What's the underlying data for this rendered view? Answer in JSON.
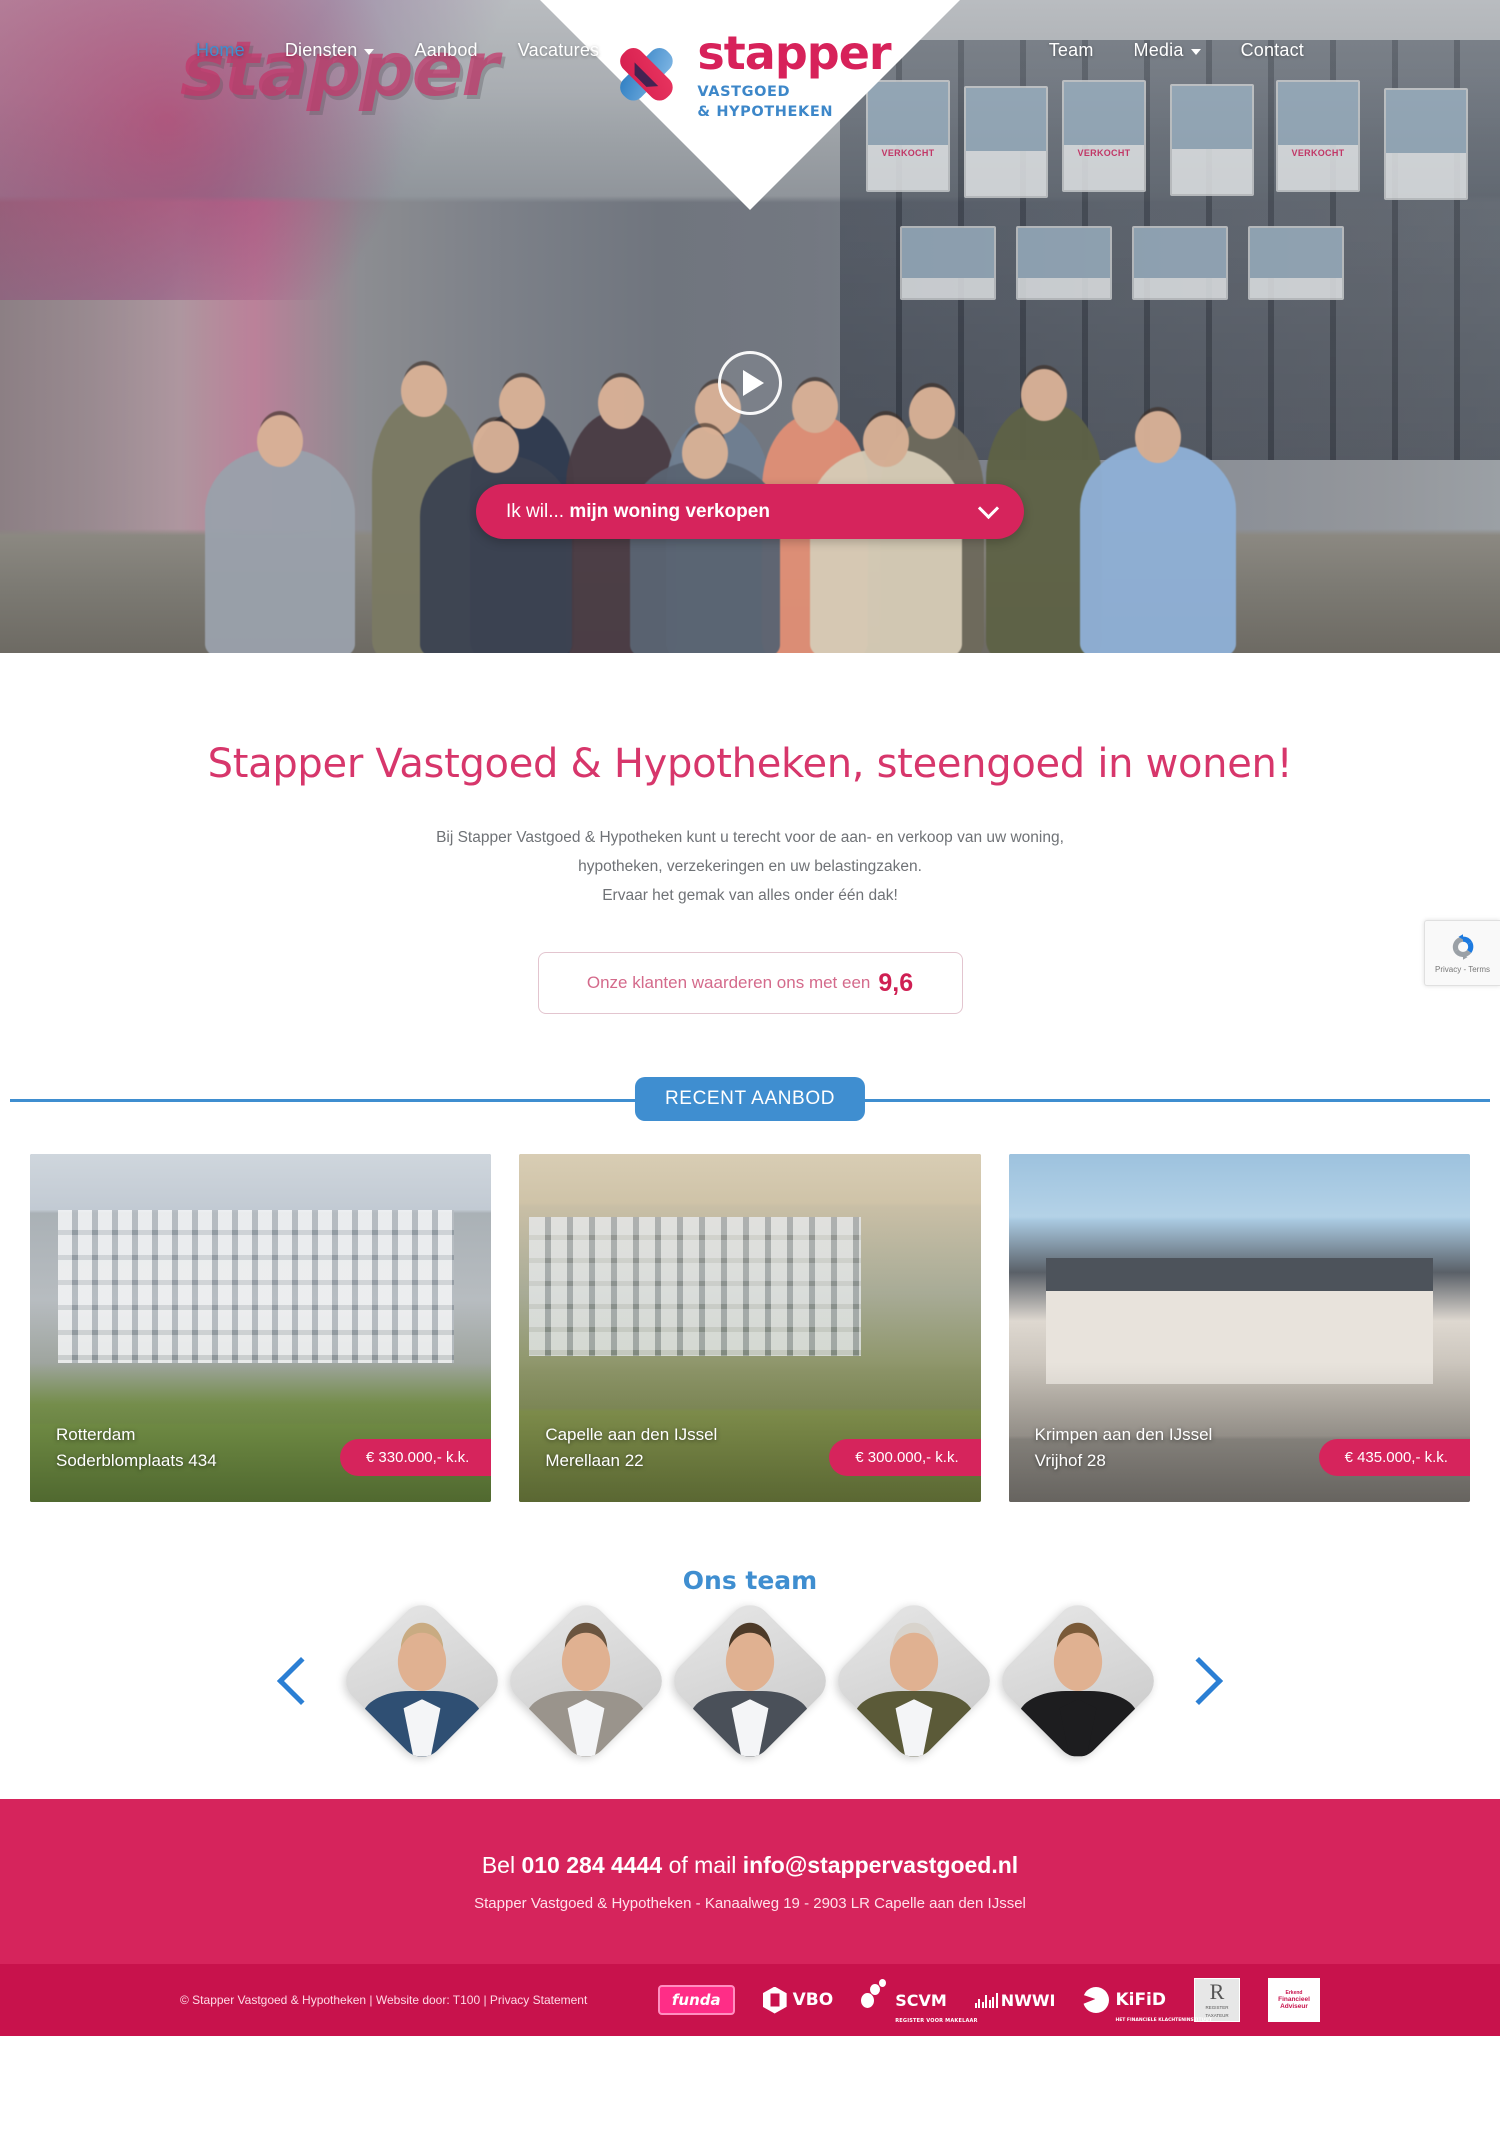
{
  "brand": {
    "word": "stapper",
    "sub1": "VASTGOED",
    "sub2": "& HYPOTHEKEN",
    "wall_sign": "stapper",
    "accent_pink": "#d6245c",
    "accent_blue": "#3f8ed0",
    "logo_blue": "#3d87c9",
    "logo_red": "#d7225a"
  },
  "nav": {
    "left": [
      {
        "label": "Home",
        "has_caret": false,
        "active": true
      },
      {
        "label": "Diensten",
        "has_caret": true,
        "active": false
      },
      {
        "label": "Aanbod",
        "has_caret": false,
        "active": false
      },
      {
        "label": "Vacatures",
        "has_caret": false,
        "active": false
      }
    ],
    "right": [
      {
        "label": "Team",
        "has_caret": false
      },
      {
        "label": "Media",
        "has_caret": true
      },
      {
        "label": "Contact",
        "has_caret": false
      }
    ]
  },
  "hero": {
    "play_icon": "play-icon",
    "cta_prefix": "Ik wil...",
    "cta_strong": "mijn woning verkopen",
    "cta_icon": "chevron-down-icon",
    "posters": [
      "VERKOCHT",
      "VERKOCHT",
      "VERKOCHT"
    ]
  },
  "intro": {
    "heading": "Stapper Vastgoed & Hypotheken, steengoed in wonen!",
    "paragraph_lines": [
      "Bij Stapper Vastgoed & Hypotheken kunt u terecht voor de aan- en verkoop van uw woning,",
      "hypotheken, verzekeringen en uw belastingzaken.",
      "Ervaar het gemak van alles onder één dak!"
    ],
    "line1": "Bij Stapper Vastgoed & Hypotheken kunt u terecht voor de aan- en verkoop van uw woning,",
    "line2": "hypotheken, verzekeringen en uw belastingzaken.",
    "line3": "Ervaar het gemak van alles onder één dak!",
    "rating_text": "Onze klanten waarderen ons met een",
    "rating_value": "9,6"
  },
  "recaptcha": {
    "label": "Privacy - Terms",
    "icon": "recaptcha-icon"
  },
  "listings": {
    "section_title": "RECENT AANBOD",
    "items": [
      {
        "city": "Rotterdam",
        "street": "Soderblomplaats 434",
        "price": "€ 330.000,- k.k."
      },
      {
        "city": "Capelle aan den IJssel",
        "street": "Merellaan 22",
        "price": "€ 300.000,- k.k."
      },
      {
        "city": "Krimpen aan den IJssel",
        "street": "Vrijhof 28",
        "price": "€ 435.000,- k.k."
      }
    ]
  },
  "team": {
    "title": "Ons team",
    "prev_icon": "chevron-left-icon",
    "next_icon": "chevron-right-icon",
    "members": [
      {
        "suit": "#2f4f73",
        "hair": "#c9ab82"
      },
      {
        "suit": "#9a948c",
        "hair": "#6b5540"
      },
      {
        "suit": "#4a5059",
        "hair": "#4d3a28"
      },
      {
        "suit": "#5b5a38",
        "hair": "#d8d3cc"
      },
      {
        "suit": "#1d1d1f",
        "hair": "#7a5a38"
      }
    ]
  },
  "footer": {
    "call_prefix": "Bel",
    "phone": "010 284 4444",
    "mail_mid": "of mail",
    "email": "info@stappervastgoed.nl",
    "address": "Stapper Vastgoed & Hypotheken - Kanaalweg 19 - 2903 LR Capelle aan den IJssel",
    "copyright": "© Stapper Vastgoed & Hypotheken  |  Website door: T100 | Privacy Statement",
    "partners": [
      {
        "name": "funda"
      },
      {
        "name": "VBO"
      },
      {
        "name": "SCVM",
        "sub": "REGISTER VOOR MAKELAAR"
      },
      {
        "name": "NWWI"
      },
      {
        "name": "KiFiD",
        "sub": "HET FINANCIELE KLACHTENINSTITUUT"
      },
      {
        "name": "R",
        "line1": "REGISTER",
        "line2": "TAXATEUR"
      },
      {
        "name": "Erkend",
        "line1": "Financieel",
        "line2": "Adviseur"
      }
    ]
  }
}
